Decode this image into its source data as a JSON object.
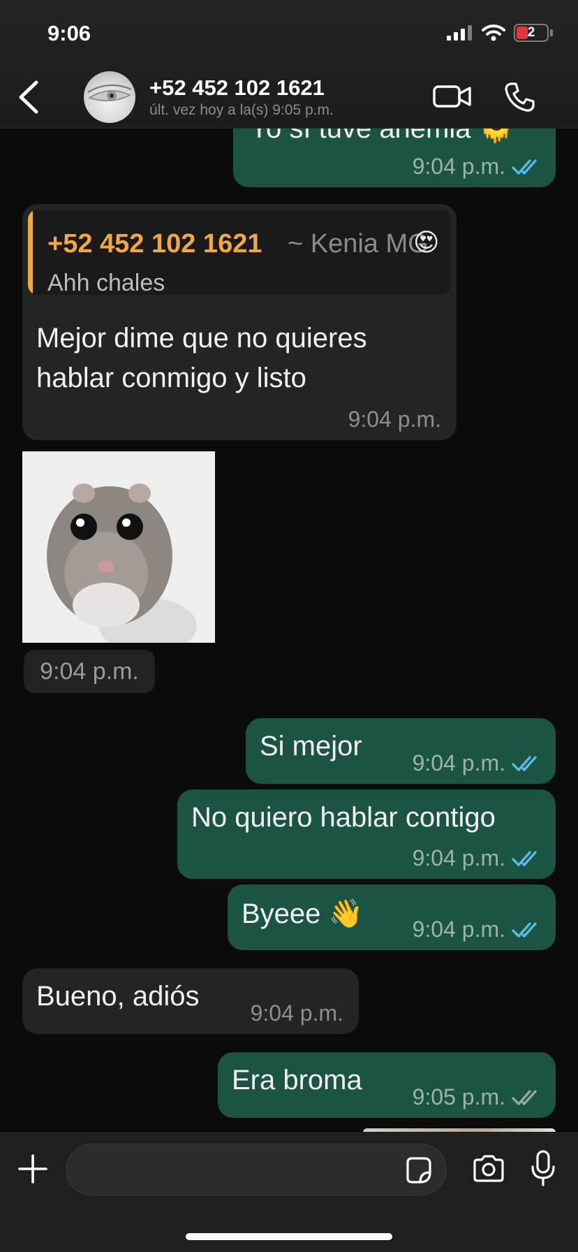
{
  "status_bar": {
    "time": "9:06",
    "battery_level": "2",
    "signal_icon": "signal-icon",
    "wifi_icon": "wifi-icon"
  },
  "header": {
    "contact_name": "+52 452 102 1621",
    "last_seen": "últ. vez hoy a la(s) 9:05 p.m.",
    "icons": [
      "back-icon",
      "video-call-icon",
      "phone-call-icon"
    ]
  },
  "messages": [
    {
      "direction": "out",
      "text": "Yo sí tuve anemia 🫠",
      "time": "9:04 p.m.",
      "ticks": "read"
    },
    {
      "direction": "in",
      "quote": {
        "author": "+52 452 102 1621",
        "author_suffix": "~ Kenia MG",
        "emoji": "😍",
        "text": "Ahh chales"
      },
      "text_line1": "Mejor dime que no quieres",
      "text_line2": "hablar conmigo y listo",
      "time": "9:04 p.m."
    },
    {
      "direction": "in",
      "type": "image",
      "image_subject": "hamster",
      "time": "9:04 p.m."
    },
    {
      "direction": "out",
      "text": "Si mejor",
      "time": "9:04 p.m.",
      "ticks": "read"
    },
    {
      "direction": "out",
      "text": "No quiero hablar contigo",
      "time": "9:04 p.m.",
      "ticks": "read"
    },
    {
      "direction": "out",
      "text": "Byeee 👋",
      "time": "9:04 p.m.",
      "ticks": "read"
    },
    {
      "direction": "in",
      "text": "Bueno, adiós",
      "time": "9:04 p.m."
    },
    {
      "direction": "out",
      "text": "Era broma",
      "time": "9:05 p.m.",
      "ticks": "delivered"
    }
  ],
  "composer": {
    "placeholder": "",
    "icons": [
      "plus-icon",
      "sticker-icon",
      "camera-icon",
      "microphone-icon"
    ]
  },
  "colors": {
    "outgoing_bubble": "#1b5443",
    "incoming_bubble": "#232425",
    "read_tick": "#53bdeb",
    "delivered_tick": "#9aa7a1",
    "quote_accent": "#f2a93b"
  }
}
